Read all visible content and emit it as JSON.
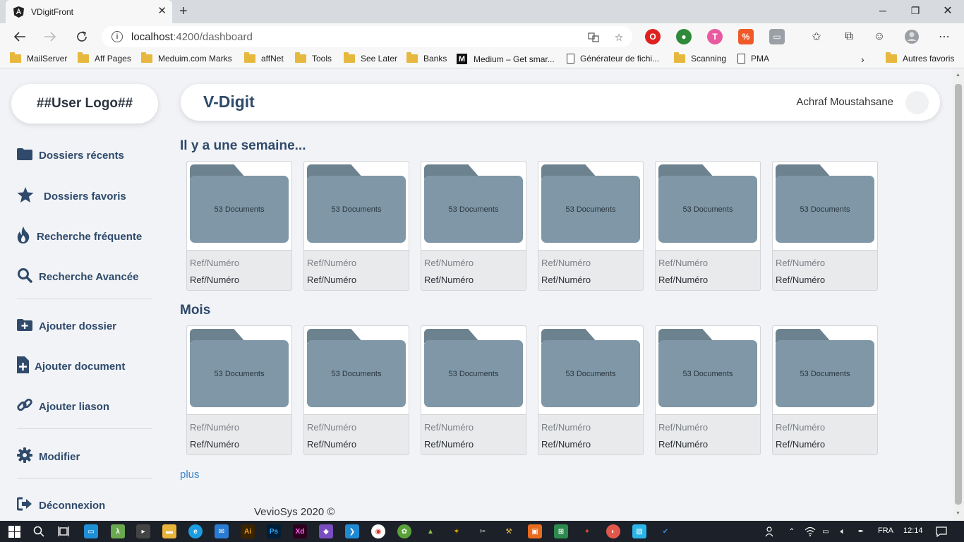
{
  "browser": {
    "tab_title": "VDigitFront",
    "url_host": "localhost",
    "url_rest": ":4200/dashboard",
    "bookmarks": [
      {
        "label": "MailServer",
        "icon": "folder-icon"
      },
      {
        "label": "Aff Pages",
        "icon": "folder-icon"
      },
      {
        "label": "Meduim.com Marks",
        "icon": "folder-icon"
      },
      {
        "label": "affNet",
        "icon": "folder-icon"
      },
      {
        "label": "Tools",
        "icon": "folder-icon"
      },
      {
        "label": "See Later",
        "icon": "folder-icon"
      },
      {
        "label": "Banks",
        "icon": "folder-icon"
      },
      {
        "label": "Medium – Get smar...",
        "icon": "medium-icon"
      },
      {
        "label": "Générateur de fichi...",
        "icon": "page-icon"
      },
      {
        "label": "Scanning",
        "icon": "folder-icon"
      },
      {
        "label": "PMA",
        "icon": "page-icon"
      }
    ],
    "other_favorites": "Autres favoris"
  },
  "sidebar": {
    "logo": "##User Logo##",
    "items": [
      {
        "label": "Dossiers récents",
        "icon": "folder-icon"
      },
      {
        "label": "Dossiers favoris",
        "icon": "star-icon"
      },
      {
        "label": "Recherche fréquente",
        "icon": "fire-icon"
      },
      {
        "label": "Recherche Avancée",
        "icon": "search-icon"
      },
      {
        "label": "Ajouter dossier",
        "icon": "folder-plus-icon"
      },
      {
        "label": "Ajouter document",
        "icon": "file-plus-icon"
      },
      {
        "label": "Ajouter liason",
        "icon": "link-icon"
      },
      {
        "label": "Modifier",
        "icon": "gear-icon"
      },
      {
        "label": "Déconnexion",
        "icon": "sign-out-icon"
      }
    ]
  },
  "header": {
    "brand": "V-Digit",
    "user_name": "Achraf Moustahsane"
  },
  "sections": [
    {
      "title": "Il y a une semaine...",
      "cards": [
        {
          "count": "53 Documents",
          "ref1": "Ref/Numéro",
          "ref2": "Ref/Numéro"
        },
        {
          "count": "53 Documents",
          "ref1": "Ref/Numéro",
          "ref2": "Ref/Numéro"
        },
        {
          "count": "53 Documents",
          "ref1": "Ref/Numéro",
          "ref2": "Ref/Numéro"
        },
        {
          "count": "53 Documents",
          "ref1": "Ref/Numéro",
          "ref2": "Ref/Numéro"
        },
        {
          "count": "53 Documents",
          "ref1": "Ref/Numéro",
          "ref2": "Ref/Numéro"
        },
        {
          "count": "53 Documents",
          "ref1": "Ref/Numéro",
          "ref2": "Ref/Numéro"
        }
      ]
    },
    {
      "title": "Mois",
      "cards": [
        {
          "count": "53 Documents",
          "ref1": "Ref/Numéro",
          "ref2": "Ref/Numéro"
        },
        {
          "count": "53 Documents",
          "ref1": "Ref/Numéro",
          "ref2": "Ref/Numéro"
        },
        {
          "count": "53 Documents",
          "ref1": "Ref/Numéro",
          "ref2": "Ref/Numéro"
        },
        {
          "count": "53 Documents",
          "ref1": "Ref/Numéro",
          "ref2": "Ref/Numéro"
        },
        {
          "count": "53 Documents",
          "ref1": "Ref/Numéro",
          "ref2": "Ref/Numéro"
        },
        {
          "count": "53 Documents",
          "ref1": "Ref/Numéro",
          "ref2": "Ref/Numéro"
        }
      ]
    }
  ],
  "more_link": "plus",
  "footer": "VevioSys 2020 ©",
  "taskbar": {
    "language": "FRA",
    "time": "12:14"
  },
  "colors": {
    "accent": "#2f4a6b",
    "folder": "#7f97a6",
    "folder_tab": "#6d828f",
    "link": "#3a86c8"
  }
}
